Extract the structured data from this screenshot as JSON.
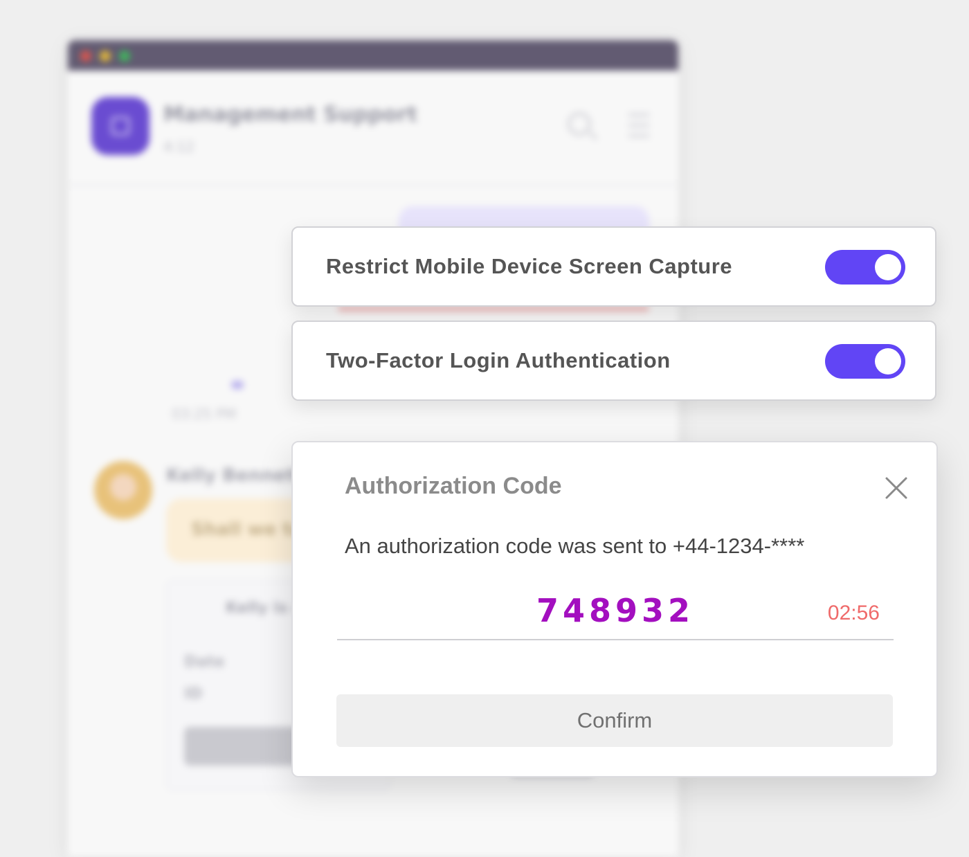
{
  "background": {
    "app_title": "Management Support",
    "app_subtitle": "4:12",
    "message_time": "03:25 PM",
    "sender_name": "Kelly Bennett",
    "message_preview": "Shall we ta",
    "card_header": "Kelly is a",
    "card_row_date": "Date",
    "card_row_id": "ID"
  },
  "settings": {
    "screen_capture_label": "Restrict Mobile Device Screen Capture",
    "screen_capture_enabled": true,
    "two_factor_label": "Two-Factor Login Authentication",
    "two_factor_enabled": true
  },
  "auth_dialog": {
    "title": "Authorization Code",
    "description": "An authorization code was sent to +44-1234-****",
    "code": "748932",
    "timer": "02:56",
    "confirm_label": "Confirm"
  },
  "colors": {
    "accent": "#6145f5",
    "code_color": "#a30fbf",
    "timer_color": "#ef6a6a",
    "titlebar": "#625b72"
  },
  "icons": [
    "close-icon",
    "search-icon",
    "menu-icon",
    "app-icon"
  ]
}
